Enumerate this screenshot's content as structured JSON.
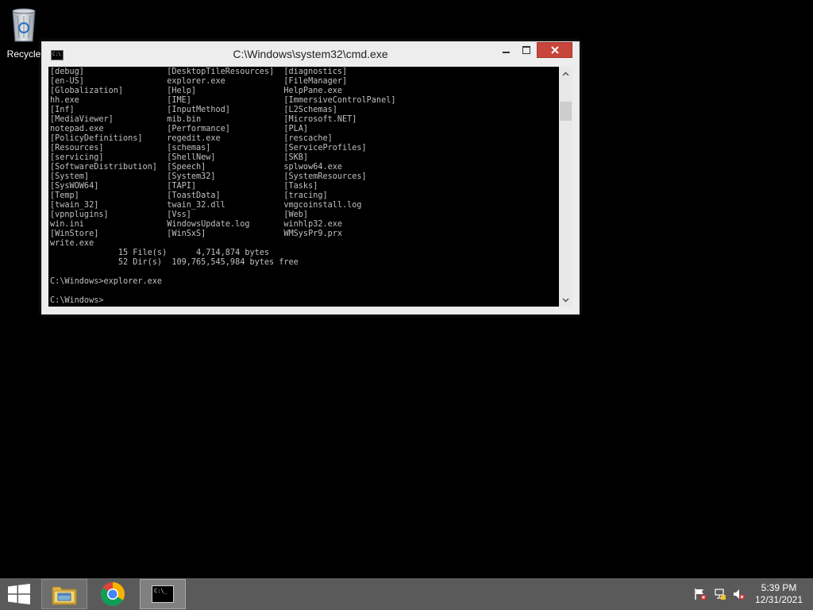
{
  "desktop": {
    "icons": [
      {
        "label": "Recycle",
        "icon": "recycle-bin-icon"
      }
    ]
  },
  "cmd_window": {
    "title": "C:\\Windows\\system32\\cmd.exe",
    "buttons": {
      "minimize": "minimize-icon",
      "maximize": "maximize-icon",
      "close": "close-icon"
    },
    "console_lines": [
      "[debug]                 [DesktopTileResources]  [diagnostics]",
      "[en-US]                 explorer.exe            [FileManager]",
      "[Globalization]         [Help]                  HelpPane.exe",
      "hh.exe                  [IME]                   [ImmersiveControlPanel]",
      "[Inf]                   [InputMethod]           [L2Schemas]",
      "[MediaViewer]           mib.bin                 [Microsoft.NET]",
      "notepad.exe             [Performance]           [PLA]",
      "[PolicyDefinitions]     regedit.exe             [rescache]",
      "[Resources]             [schemas]               [ServiceProfiles]",
      "[servicing]             [ShellNew]              [SKB]",
      "[SoftwareDistribution]  [Speech]                splwow64.exe",
      "[System]                [System32]              [SystemResources]",
      "[SysWOW64]              [TAPI]                  [Tasks]",
      "[Temp]                  [ToastData]             [tracing]",
      "[twain_32]              twain_32.dll            vmgcoinstall.log",
      "[vpnplugins]            [Vss]                   [Web]",
      "win.ini                 WindowsUpdate.log       winhlp32.exe",
      "[WinStore]              [WinSxS]                WMSysPr9.prx",
      "write.exe",
      "              15 File(s)      4,714,874 bytes",
      "              52 Dir(s)  109,765,545,984 bytes free",
      "",
      "C:\\Windows>explorer.exe",
      "",
      "C:\\Windows>"
    ]
  },
  "taskbar": {
    "start": "windows-start-icon",
    "pinned": [
      {
        "name": "File Explorer",
        "icon": "file-explorer-icon"
      },
      {
        "name": "Google Chrome",
        "icon": "chrome-icon"
      },
      {
        "name": "Command Prompt",
        "icon": "cmd-icon",
        "tile_text": "C:\\_"
      }
    ],
    "tray": [
      "action-center-flag-icon",
      "network-icon",
      "volume-muted-icon"
    ],
    "time": "5:39 PM",
    "date": "12/31/2021"
  },
  "colors": {
    "desktop_bg": "#000000",
    "taskbar_bg": "#5a5a5a",
    "console_bg": "#000000",
    "console_fg": "#c0c0c0",
    "close_button": "#c7453a",
    "window_frame": "#ededed"
  }
}
